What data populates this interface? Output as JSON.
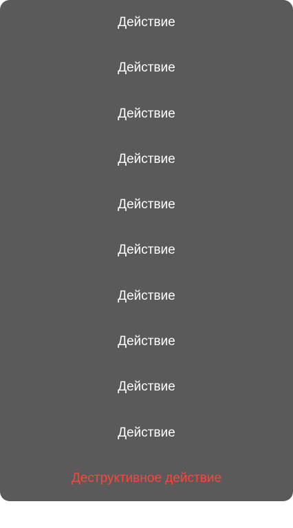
{
  "action_sheet": {
    "actions": [
      {
        "label": "Действие"
      },
      {
        "label": "Действие"
      },
      {
        "label": "Действие"
      },
      {
        "label": "Действие"
      },
      {
        "label": "Действие"
      },
      {
        "label": "Действие"
      },
      {
        "label": "Действие"
      },
      {
        "label": "Действие"
      },
      {
        "label": "Действие"
      },
      {
        "label": "Действие"
      }
    ],
    "destructive_label": "Деструктивное действие",
    "colors": {
      "background": "#5a5a5a",
      "text": "#ffffff",
      "destructive": "#ff453a"
    }
  }
}
